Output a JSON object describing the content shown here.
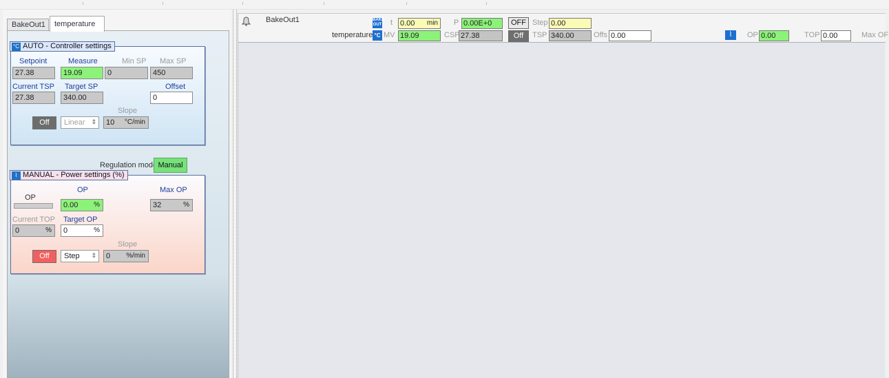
{
  "left_panel": {
    "tabs": [
      {
        "label": "BakeOut1"
      },
      {
        "label": "temperature"
      }
    ],
    "auto": {
      "title": "AUTO - Controller settings",
      "icon": "thermometer-icon",
      "setpoint_label": "Setpoint",
      "setpoint": "27.38",
      "measure_label": "Measure",
      "measure": "19.09",
      "min_sp_label": "Min SP",
      "min_sp": "0",
      "max_sp_label": "Max SP",
      "max_sp": "450",
      "current_tsp_label": "Current TSP",
      "current_tsp": "27.38",
      "target_sp_label": "Target SP",
      "target_sp": "340.00",
      "offset_label": "Offset",
      "offset": "0",
      "slope_label": "Slope",
      "off_button": "Off",
      "ramp_mode": "Linear",
      "slope_value": "10",
      "slope_unit": "°C/min"
    },
    "regulation_mode_label": "Regulation mode",
    "regulation_mode_button": "Manual",
    "manual": {
      "title": "MANUAL - Power settings (%)",
      "icon": "waveform-icon",
      "op_bar_label": "OP",
      "op_label": "OP",
      "op_value": "0.00",
      "op_unit": "%",
      "max_op_label": "Max OP",
      "max_op": "32",
      "max_op_unit": "%",
      "current_top_label": "Current TOP",
      "current_top": "0",
      "current_top_unit": "%",
      "target_op_label": "Target OP",
      "target_op": "0",
      "target_op_unit": "%",
      "slope_label": "Slope",
      "off_button": "Off",
      "ramp_mode": "Step",
      "slope_value": "0",
      "slope_unit": "%/min"
    }
  },
  "status_strip": {
    "device": "BakeOut1",
    "channel": "temperature",
    "bake_icon_text": "BAKE OUT",
    "t_label": "t",
    "t_value": "0.00",
    "t_unit": "min",
    "p_label": "P",
    "p_value": "0.00E+0",
    "off_button_1": "OFF",
    "step_label": "Step",
    "step_value": "0.00",
    "mv_label": "MV",
    "mv_value": "19.09",
    "csp_label": "CSP",
    "csp_value": "27.38",
    "off_button_2": "Off",
    "tsp_label": "TSP",
    "tsp_value": "340.00",
    "offs_label": "Offs",
    "offs_value": "0.00",
    "op_label": "OP",
    "op_value": "0.00",
    "top_label": "TOP",
    "top_value": "0.00",
    "max_label": "Max OF"
  }
}
